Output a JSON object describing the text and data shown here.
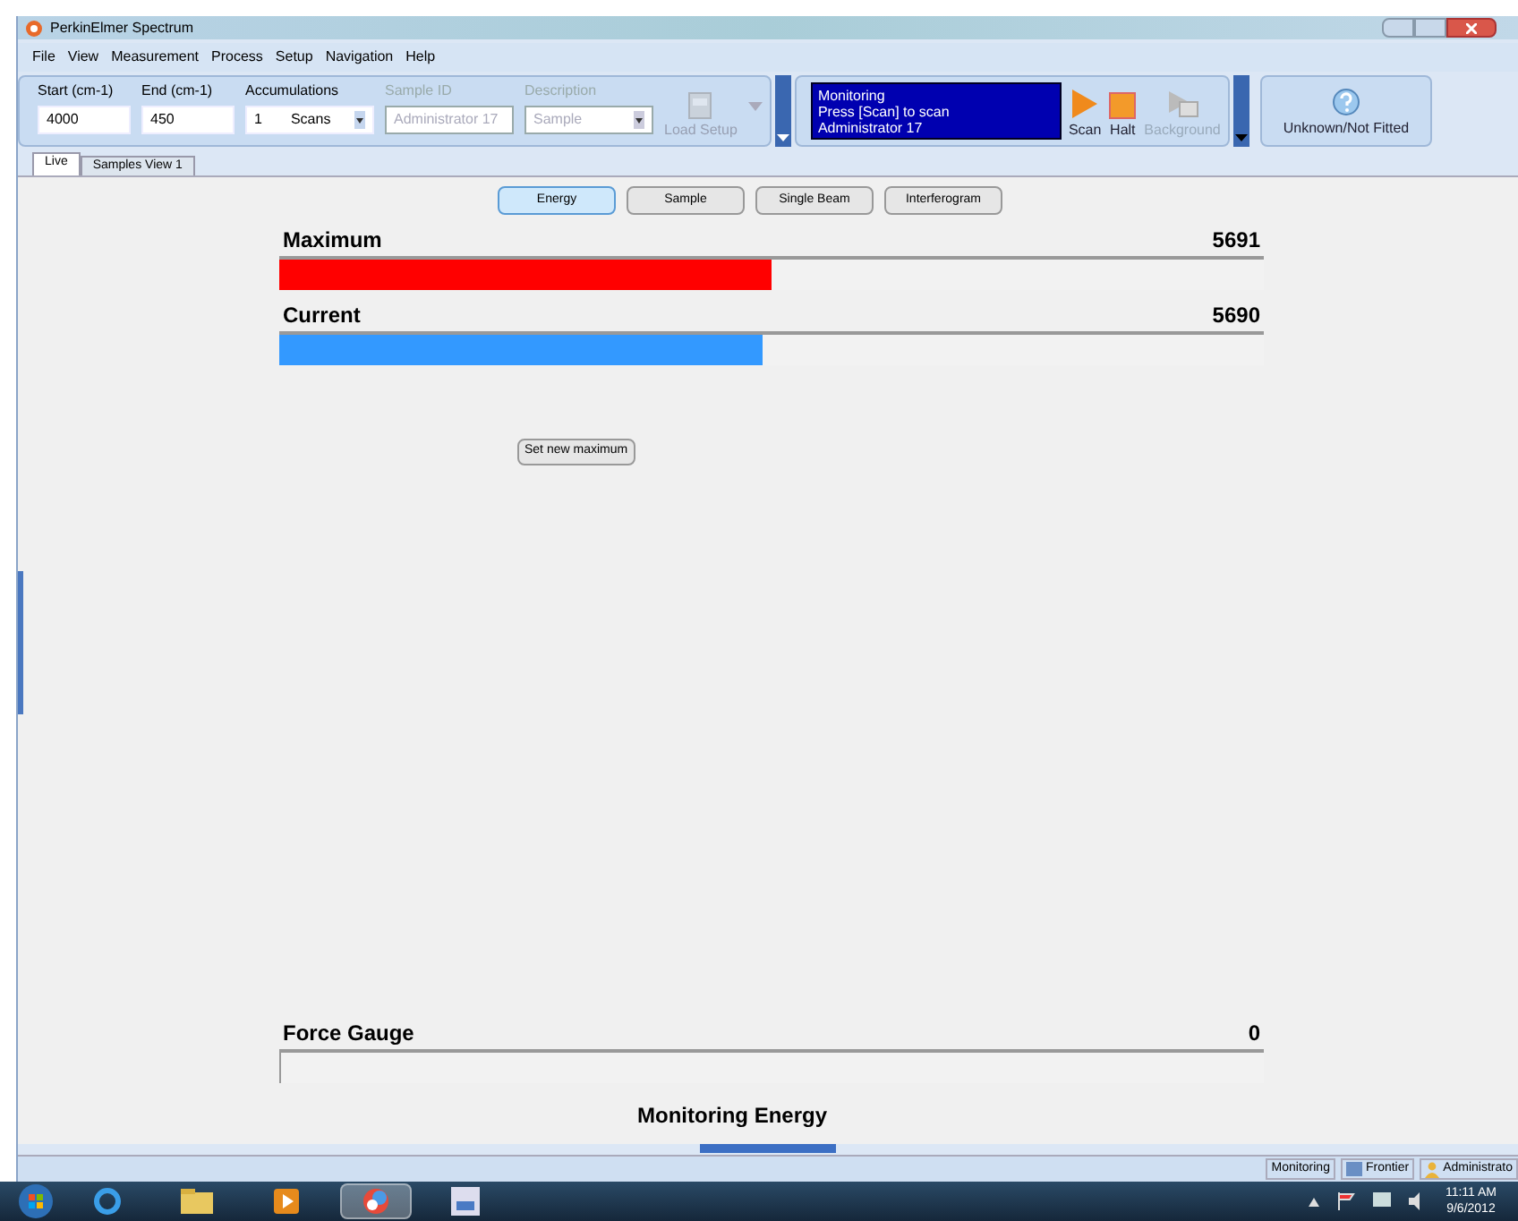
{
  "window": {
    "title": "PerkinElmer Spectrum"
  },
  "menu": [
    "File",
    "View",
    "Measurement",
    "Process",
    "Setup",
    "Navigation",
    "Help"
  ],
  "toolbar": {
    "fields": [
      {
        "label": "Start (cm-1)",
        "value": "4000",
        "disabled": false,
        "kind": "text"
      },
      {
        "label": "End (cm-1)",
        "value": "450",
        "disabled": false,
        "kind": "text"
      },
      {
        "label": "Accumulations",
        "value": "1",
        "unit": "Scans",
        "disabled": false,
        "kind": "combo"
      },
      {
        "label": "Sample ID",
        "value": "Administrator 17",
        "disabled": true,
        "kind": "text"
      },
      {
        "label": "Description",
        "value": "Sample",
        "disabled": true,
        "kind": "combo"
      }
    ],
    "load_setup": {
      "label": "Load Setup",
      "disabled": true
    },
    "monitor_lines": [
      "Monitoring",
      "Press [Scan] to scan",
      "Administrator 17"
    ],
    "actions": [
      {
        "label": "Scan",
        "kind": "scan",
        "disabled": false
      },
      {
        "label": "Halt",
        "kind": "halt",
        "disabled": false
      },
      {
        "label": "Background",
        "kind": "background",
        "disabled": true
      }
    ],
    "accessory": {
      "label": "Unknown/Not Fitted"
    }
  },
  "tabs": [
    {
      "label": "Live",
      "selected": true
    },
    {
      "label": "Samples View 1",
      "selected": false
    }
  ],
  "view_buttons": [
    {
      "label": "Energy",
      "selected": true
    },
    {
      "label": "Sample",
      "selected": false
    },
    {
      "label": "Single Beam",
      "selected": false
    },
    {
      "label": "Interferogram",
      "selected": false
    }
  ],
  "meters": [
    {
      "label": "Maximum",
      "reading": "5691",
      "level": 0.5,
      "color": "#ff0000"
    },
    {
      "label": "Current",
      "reading": "5690",
      "level": 0.49,
      "color": "#3399ff"
    }
  ],
  "set_max_button": "Set new maximum",
  "force_gauge": {
    "label": "Force Gauge",
    "reading": "0"
  },
  "footer_text": "Monitoring Energy",
  "status_bar": [
    {
      "label": "Monitoring",
      "kind": "text"
    },
    {
      "label": "Frontier",
      "kind": "instrument"
    },
    {
      "label": "Administrato",
      "kind": "user"
    }
  ],
  "taskbar": {
    "apps": [
      {
        "kind": "ie",
        "selected": false
      },
      {
        "kind": "folder",
        "selected": false
      },
      {
        "kind": "media",
        "selected": false
      },
      {
        "kind": "spectrum",
        "selected": true
      },
      {
        "kind": "doc",
        "selected": false
      }
    ],
    "time": "11:11 AM",
    "date": "9/6/2012"
  }
}
